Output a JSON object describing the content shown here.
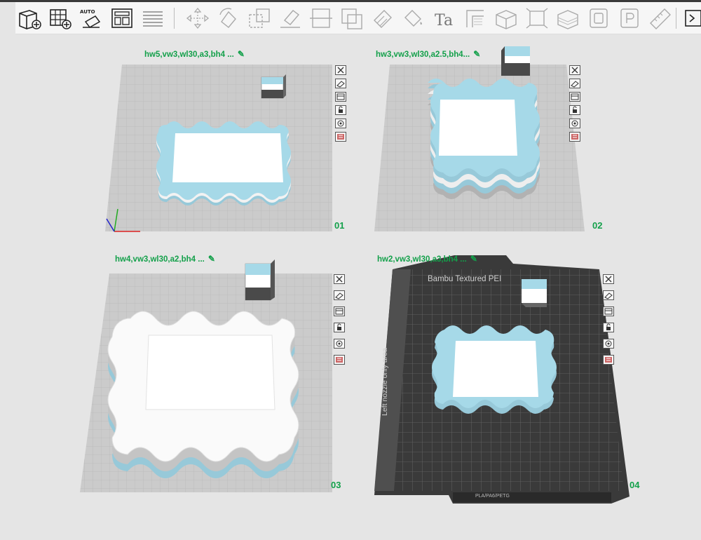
{
  "toolbar": {
    "auto_label": "AUTO",
    "text_tool_label": "Ta",
    "buttons": [
      {
        "name": "add-object-icon"
      },
      {
        "name": "add-plate-icon"
      },
      {
        "name": "auto-orient-icon"
      },
      {
        "name": "arrange-icon"
      },
      {
        "name": "split-icon"
      },
      {
        "name": "move-icon"
      },
      {
        "name": "rotate-icon"
      },
      {
        "name": "scale-icon"
      },
      {
        "name": "lay-on-face-icon"
      },
      {
        "name": "cut-icon"
      },
      {
        "name": "boolean-icon"
      },
      {
        "name": "support-paint-icon"
      },
      {
        "name": "color-paint-icon"
      },
      {
        "name": "text-icon"
      },
      {
        "name": "seam-paint-icon"
      },
      {
        "name": "fuzzy-skin-icon"
      },
      {
        "name": "emboss-icon"
      },
      {
        "name": "variable-layer-icon"
      },
      {
        "name": "flatten-icon"
      },
      {
        "name": "mesh-icon"
      },
      {
        "name": "measure-icon"
      },
      {
        "name": "assembly-icon"
      }
    ]
  },
  "plates": [
    {
      "id": "01",
      "label": "hw5,vw3,wl30,a3,bh4 ...",
      "number": "01",
      "bed": "gray"
    },
    {
      "id": "02",
      "label": "hw3,vw3,wl30,a2.5,bh4...",
      "number": "02",
      "bed": "gray"
    },
    {
      "id": "03",
      "label": "hw4,vw3,wl30,a2,bh4 ...",
      "number": "03",
      "bed": "gray"
    },
    {
      "id": "04",
      "label": "hw2,vw3,wl30,a3,bh4 ...",
      "number": "04",
      "bed": "textured"
    }
  ],
  "plate_side_icons": [
    "close-plate-icon",
    "arrange-plate-icon",
    "orient-plate-icon",
    "lock-plate-icon",
    "plate-settings-icon",
    "slice-plate-icon"
  ],
  "bed_texts": {
    "name": "Bambu Textured PEI",
    "left_nozzle": "Left nozzle only area",
    "filament_types": "PLA/PA6/PETG"
  },
  "colors": {
    "accent_green": "#13a04a",
    "model_blue": "#a6d9e8",
    "model_white": "#fafafa",
    "bed_gray": "#c8c8c8",
    "textured_bed": "#3a3a3a"
  }
}
